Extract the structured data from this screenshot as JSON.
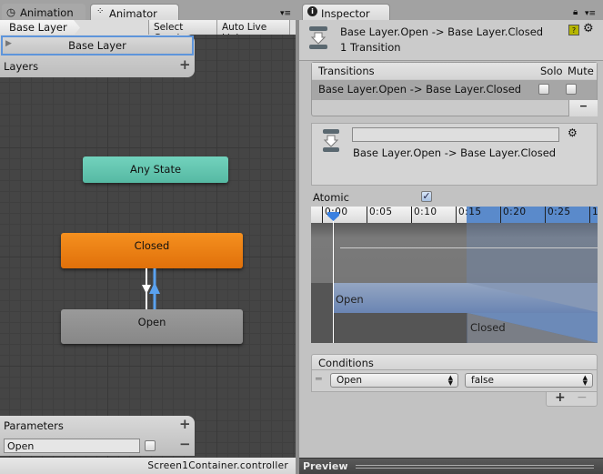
{
  "animator": {
    "tabs": [
      {
        "label": "Animation",
        "icon": "clock-icon"
      },
      {
        "label": "Animator",
        "icon": "animator-icon"
      }
    ],
    "breadcrumb": "Base Layer",
    "select_graph": "Select Graph",
    "auto_live_link": "Auto Live Link",
    "layers": {
      "header": "Layers",
      "items": [
        {
          "label": "Base Layer",
          "selected": true
        }
      ]
    },
    "states": [
      {
        "label": "Any State",
        "color": "#5fc4ae"
      },
      {
        "label": "Closed",
        "color": "#e87a0d"
      },
      {
        "label": "Open",
        "color": "#8e8e8e"
      }
    ],
    "parameters": {
      "header": "Parameters",
      "items": [
        {
          "name": "Open",
          "value": false
        }
      ]
    },
    "status": "Screen1Container.controller"
  },
  "inspector": {
    "tab": "Inspector",
    "title": "Base Layer.Open -> Base Layer.Closed",
    "subtitle": "1 Transition",
    "transitions": {
      "header": "Transitions",
      "solo": "Solo",
      "mute": "Mute",
      "rows": [
        {
          "label": "Base Layer.Open -> Base Layer.Closed",
          "solo": false,
          "mute": false
        }
      ]
    },
    "transition_name": "",
    "transition_label": "Base Layer.Open -> Base Layer.Closed",
    "atomic_label": "Atomic",
    "atomic": true,
    "timeline": {
      "ticks": [
        "0:00",
        "0:05",
        "0:10",
        "0:15",
        "0:20",
        "0:25",
        "1"
      ],
      "source": "Open",
      "destination": "Closed"
    },
    "conditions": {
      "header": "Conditions",
      "rows": [
        {
          "parameter": "Open",
          "value": "false"
        }
      ]
    },
    "preview": "Preview",
    "accent": "#5a8acb"
  }
}
